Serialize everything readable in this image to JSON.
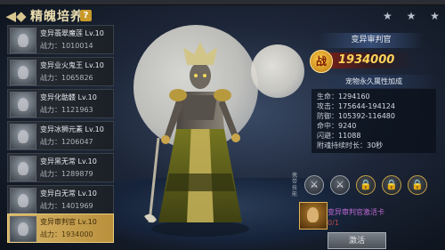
{
  "header": {
    "back_icon": "back-arrow-icon",
    "title": "精魄培养",
    "help_label": "?",
    "stars": "★ ★ ★"
  },
  "pet_list": [
    {
      "name": "变异翡翠魔莲 Lv.10",
      "power": "战力：1010014",
      "selected": false
    },
    {
      "name": "变异业火鬼王 Lv.10",
      "power": "战力：1065826",
      "selected": false
    },
    {
      "name": "变异化骷髅 Lv.10",
      "power": "战力：1121963",
      "selected": false
    },
    {
      "name": "变异冰狮元素 Lv.10",
      "power": "战力：1206047",
      "selected": false
    },
    {
      "name": "变异黑无常 Lv.10",
      "power": "战力：1289879",
      "selected": false
    },
    {
      "name": "变异白无常 Lv.10",
      "power": "战力：1401969",
      "selected": false
    },
    {
      "name": "变异审判官 Lv.10",
      "power": "战力：1934000",
      "selected": true
    }
  ],
  "detail": {
    "pet_name": "变异审判官",
    "power_badge": "战",
    "power_value": "1934000",
    "permanent_title": "宠物永久属性加成",
    "stats": [
      {
        "label": "生命：",
        "value": "1294160"
      },
      {
        "label": "攻击：",
        "value": "175644-194124"
      },
      {
        "label": "防御：",
        "value": "105392-116480"
      },
      {
        "label": "命中：",
        "value": "9240"
      },
      {
        "label": "闪避：",
        "value": "11088"
      },
      {
        "label": "附魂持续时长：",
        "value": "30秒"
      }
    ],
    "skill_label": "携带技能",
    "skills": [
      {
        "icon": "claw-skill-icon",
        "glyph": "⚔",
        "locked": false
      },
      {
        "icon": "blade-skill-icon",
        "glyph": "⚔",
        "locked": false
      },
      {
        "icon": "lock-icon",
        "glyph": "🔒",
        "locked": true
      },
      {
        "icon": "lock-icon",
        "glyph": "🔒",
        "locked": true
      },
      {
        "icon": "lock-icon",
        "glyph": "🔒",
        "locked": true
      }
    ],
    "card_name": "变异审判官激活卡",
    "card_count": "0/1",
    "activate_label": "激活"
  },
  "colors": {
    "accent_gold": "#d6b56a",
    "power_gold": "#ffd35a",
    "card_purple": "#c06ad6"
  }
}
